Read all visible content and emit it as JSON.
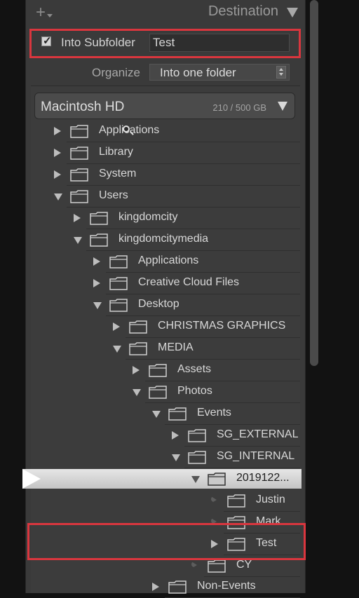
{
  "header": {
    "title": "Destination"
  },
  "subfolder": {
    "checkbox_label": "Into Subfolder",
    "checked": true,
    "value": "Test"
  },
  "organize": {
    "label": "Organize",
    "selected": "Into one folder"
  },
  "volume": {
    "name": "Macintosh HD",
    "size": "210 / 500 GB"
  },
  "tree": [
    {
      "label": "Applications",
      "state": "collapsed"
    },
    {
      "label": "Library",
      "state": "collapsed"
    },
    {
      "label": "System",
      "state": "collapsed"
    },
    {
      "label": "Users",
      "state": "expanded"
    },
    {
      "label": "kingdomcity",
      "state": "collapsed"
    },
    {
      "label": "kingdomcitymedia",
      "state": "expanded"
    },
    {
      "label": "Applications",
      "state": "collapsed"
    },
    {
      "label": "Creative Cloud Files",
      "state": "collapsed"
    },
    {
      "label": "Desktop",
      "state": "expanded"
    },
    {
      "label": "CHRISTMAS GRAPHICS",
      "state": "collapsed"
    },
    {
      "label": "MEDIA",
      "state": "expanded"
    },
    {
      "label": "Assets",
      "state": "collapsed"
    },
    {
      "label": "Photos",
      "state": "expanded"
    },
    {
      "label": "Events",
      "state": "expanded"
    },
    {
      "label": "SG_EXTERNAL",
      "state": "collapsed"
    },
    {
      "label": "SG_INTERNAL",
      "state": "expanded"
    },
    {
      "label": "2019122...",
      "state": "expanded",
      "selected": true
    },
    {
      "label": "Justin",
      "state": "empty"
    },
    {
      "label": "Mark",
      "state": "empty"
    },
    {
      "label": "Test",
      "state": "collapsed"
    },
    {
      "label": "CY",
      "state": "empty"
    },
    {
      "label": "Non-Events",
      "state": "collapsed"
    }
  ],
  "colors": {
    "panel": "#3a3a3a",
    "highlight": "#d9363e",
    "selection": "#d8d8d8"
  }
}
